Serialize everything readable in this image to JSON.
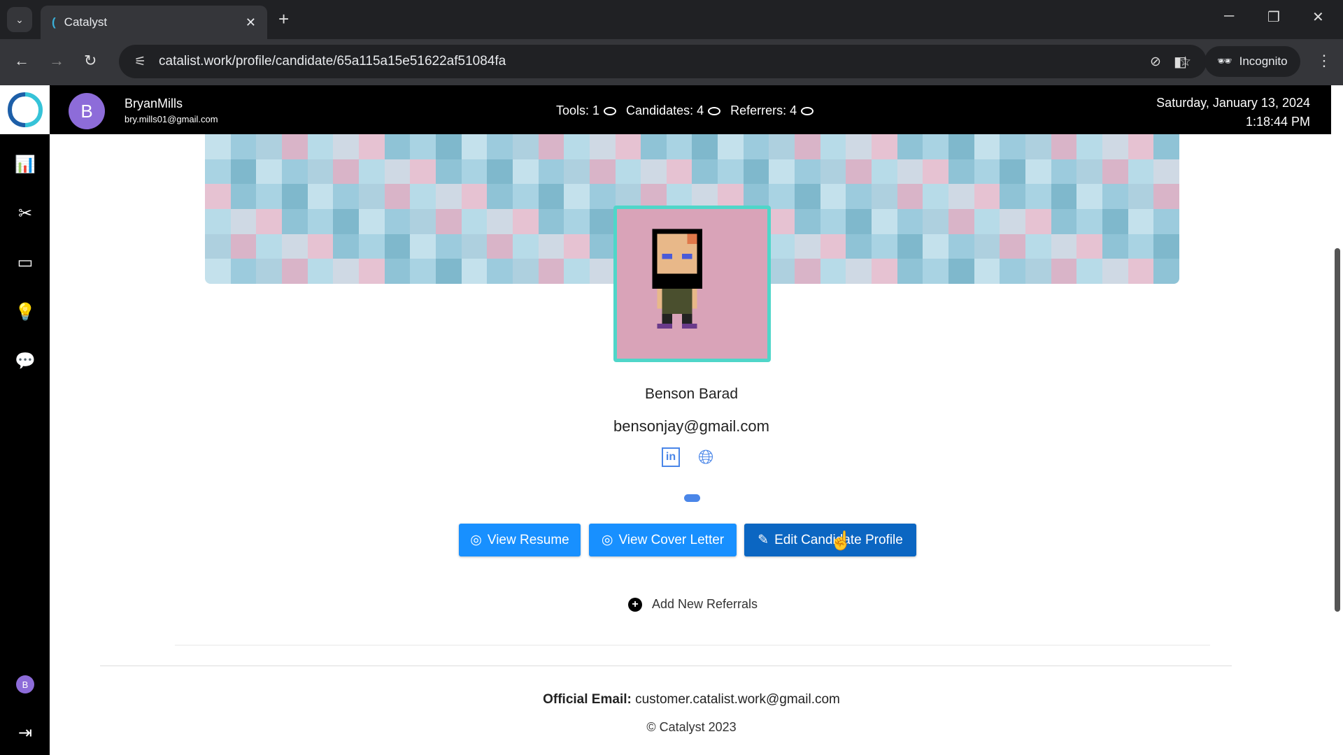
{
  "browser": {
    "tab_title": "Catalyst",
    "url": "catalist.work/profile/candidate/65a115a15e51622af51084fa",
    "incognito_label": "Incognito"
  },
  "header": {
    "user_initial": "B",
    "user_name": "BryanMills",
    "user_email": "bry.mills01@gmail.com",
    "stats": [
      {
        "label": "Tools: 1"
      },
      {
        "label": "Candidates: 4"
      },
      {
        "label": "Referrers: 4"
      }
    ],
    "date": "Saturday, January 13, 2024",
    "time": "1:18:44 PM"
  },
  "sidebar": {
    "items": [
      "chart-icon",
      "tools-icon",
      "card-icon",
      "lightbulb-icon",
      "message-icon"
    ],
    "bottom_initial": "B"
  },
  "profile": {
    "name": "Benson Barad",
    "email": "bensonjay@gmail.com",
    "buttons": {
      "view_resume": "View Resume",
      "view_cover_letter": "View Cover Letter",
      "edit_profile": "Edit Candidate Profile"
    },
    "add_referrals": "Add New Referrals"
  },
  "footer": {
    "email_label": "Official Email:",
    "email": "customer.catalist.work@gmail.com",
    "copyright": "© Catalyst 2023"
  },
  "colors": {
    "primary": "#1890ff",
    "primary_hover": "#0b66c2",
    "avatar_border": "#4fd6c9",
    "link_icon": "#4a86e8"
  }
}
